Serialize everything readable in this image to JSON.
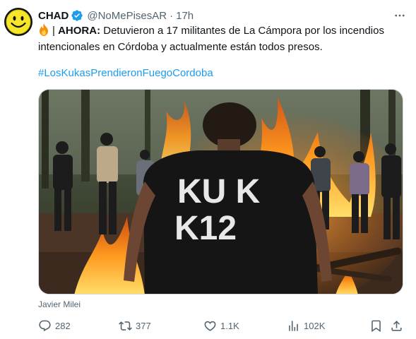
{
  "author": {
    "name": "CHAD",
    "handle": "@NoMePisesAR",
    "separator": "·",
    "time": "17h"
  },
  "tweet": {
    "emoji": "fire",
    "prefix_sep": "|",
    "label": "AHORA:",
    "text": "Detuvieron a 17 militantes de La Cámpora por los incendios intencionales en Córdoba y actualmente están todos presos.",
    "hashtag": "#LosKukasPrendieronFuegoCordoba"
  },
  "media": {
    "shirt_text_line1": "KU K",
    "shirt_text_line2": "K12",
    "caption": "Javier Milei"
  },
  "actions": {
    "replies": "282",
    "reposts": "377",
    "likes": "1.1K",
    "views": "102K"
  },
  "colors": {
    "accent": "#1d9bf0",
    "muted": "#536471",
    "text": "#0f1419",
    "avatar_face": "#f5e62a"
  }
}
